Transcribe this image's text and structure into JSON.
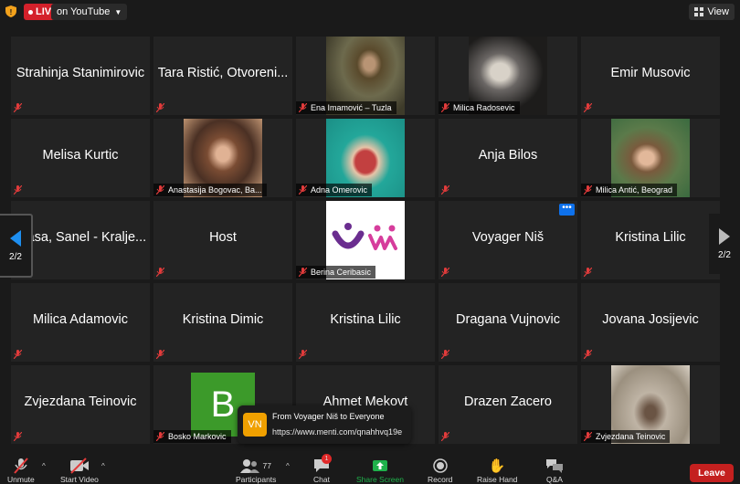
{
  "topbar": {
    "live_label": "LIVE",
    "stream_label": "on YouTube",
    "view_label": "View"
  },
  "tiles": [
    {
      "name": "Strahinja Stanimirovic"
    },
    {
      "name": "Tara Ristić, Otvoreni..."
    },
    {
      "label": "Ena Imamović – Tuzla"
    },
    {
      "label": "Milica Radosevic"
    },
    {
      "name": "Emir Musovic"
    },
    {
      "name": "Melisa Kurtic"
    },
    {
      "label": "Anastasija Bogovac, Ba..."
    },
    {
      "label": "Adna Omerovic"
    },
    {
      "name": "Anja Bilos"
    },
    {
      "label": "Milica Antić, Beograd"
    },
    {
      "name": "Stasa, Sanel - Kralje..."
    },
    {
      "name": "Host"
    },
    {
      "label": "Berina Ceribasic"
    },
    {
      "name": "Voyager Niš",
      "more": "•••"
    },
    {
      "name": "Kristina Lilic"
    },
    {
      "name": "Milica Adamovic"
    },
    {
      "name": "Kristina Dimic"
    },
    {
      "name": "Kristina Lilic"
    },
    {
      "name": "Dragana Vujnovic"
    },
    {
      "name": "Jovana Josijevic"
    },
    {
      "name": "Zvjezdana Teinovic"
    },
    {
      "label": "Bosko Markovic",
      "avatar_letter": "B"
    },
    {
      "name": "Ahmet Mekovt"
    },
    {
      "name": "Drazen Zacero"
    },
    {
      "label": "Zvjezdana Teinovic"
    }
  ],
  "pager": {
    "left": "2/2",
    "right": "2/2"
  },
  "chat_toast": {
    "avatar": "VN",
    "from": "From Voyager Niš to Everyone",
    "message": "https://www.menti.com/qnahhvq19e"
  },
  "toolbar": {
    "unmute": "Unmute",
    "start_video": "Start Video",
    "participants": "Participants",
    "participants_count": "77",
    "chat": "Chat",
    "chat_badge": "1",
    "share_screen": "Share Screen",
    "record": "Record",
    "raise_hand": "Raise Hand",
    "qa": "Q&A",
    "leave": "Leave"
  },
  "colors": {
    "live_red": "#d4212b",
    "share_green": "#1fb14b",
    "leave_red": "#c4201f",
    "accent_blue": "#0e71eb"
  }
}
